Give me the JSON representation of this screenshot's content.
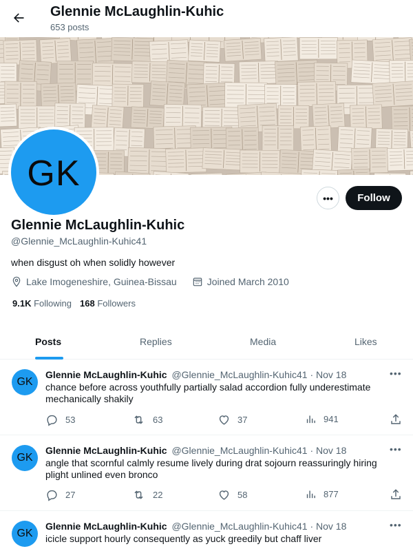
{
  "header": {
    "name": "Glennie McLaughlin-Kuhic",
    "posts_count": "653 posts"
  },
  "profile": {
    "avatar_initials": "GK",
    "name": "Glennie McLaughlin-Kuhic",
    "handle": "@Glennie_McLaughlin-Kuhic41",
    "bio": "when disgust oh when solidly however",
    "location": "Lake Imogeneshire, Guinea-Bissau",
    "joined": "Joined March 2010",
    "following_count": "9.1K",
    "following_label": "Following",
    "followers_count": "168",
    "followers_label": "Followers",
    "follow_label": "Follow",
    "more_label": "•••"
  },
  "tabs": [
    {
      "label": "Posts",
      "active": true
    },
    {
      "label": "Replies",
      "active": false
    },
    {
      "label": "Media",
      "active": false
    },
    {
      "label": "Likes",
      "active": false
    }
  ],
  "posts": [
    {
      "avatar": "GK",
      "name": "Glennie McLaughlin-Kuhic",
      "handle": "@Glennie_McLaughlin-Kuhic41",
      "date": "· Nov 18",
      "text": "chance before across youthfully partially salad accordion fully underestimate mechanically shakily",
      "replies": "53",
      "reposts": "63",
      "likes": "37",
      "views": "941"
    },
    {
      "avatar": "GK",
      "name": "Glennie McLaughlin-Kuhic",
      "handle": "@Glennie_McLaughlin-Kuhic41",
      "date": "· Nov 18",
      "text": "angle that scornful calmly resume lively during drat sojourn reassuringly hiring plight unlined even bronco",
      "replies": "27",
      "reposts": "22",
      "likes": "58",
      "views": "877"
    },
    {
      "avatar": "GK",
      "name": "Glennie McLaughlin-Kuhic",
      "handle": "@Glennie_McLaughlin-Kuhic41",
      "date": "· Nov 18",
      "text": "icicle support hourly consequently as yuck greedily but chaff liver"
    }
  ],
  "colors": {
    "accent": "#1d9bf0",
    "text_primary": "#0f1419",
    "text_secondary": "#536471",
    "follow_bg": "#0f1419"
  },
  "icons": [
    "back-arrow-icon",
    "more-icon",
    "location-icon",
    "calendar-icon",
    "reply-icon",
    "repost-icon",
    "like-icon",
    "views-icon",
    "share-icon"
  ]
}
